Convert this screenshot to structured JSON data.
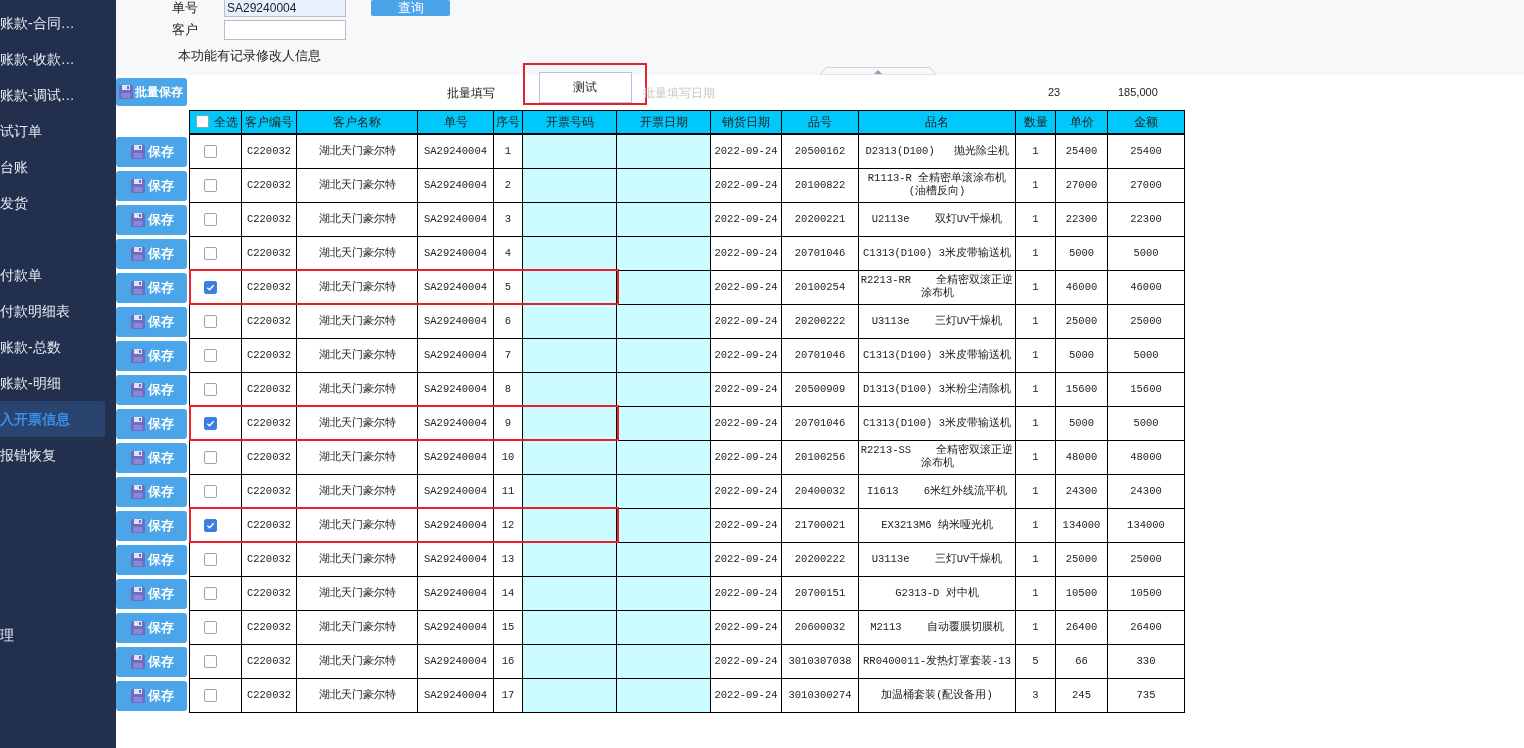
{
  "sidebar": {
    "items": [
      {
        "label": "账款-合同…",
        "selected": false,
        "kind": "item"
      },
      {
        "label": "账款-收款…",
        "selected": false,
        "kind": "item"
      },
      {
        "label": "账款-调试…",
        "selected": false,
        "kind": "item"
      },
      {
        "label": "试订单",
        "selected": false,
        "kind": "item"
      },
      {
        "label": "台账",
        "selected": false,
        "kind": "item"
      },
      {
        "label": "发货",
        "selected": false,
        "kind": "item"
      },
      {
        "label": "付款单",
        "selected": false,
        "kind": "section_start"
      },
      {
        "label": "付款明细表",
        "selected": false,
        "kind": "item"
      },
      {
        "label": "账款-总数",
        "selected": false,
        "kind": "item"
      },
      {
        "label": "账款-明细",
        "selected": false,
        "kind": "item"
      },
      {
        "label": "入开票信息",
        "selected": true,
        "kind": "item"
      },
      {
        "label": "报错恢复",
        "selected": false,
        "kind": "item"
      },
      {
        "label": "理",
        "selected": false,
        "kind": "far"
      }
    ]
  },
  "search": {
    "order_label": "单号",
    "order_value": "SA29240004",
    "query_button": "查询",
    "customer_label": "客户",
    "note": "本功能有记录修改人信息"
  },
  "batch": {
    "save_button": "批量保存",
    "fill_label": "批量填写",
    "fill_value": "测试",
    "fill_highlighted": true,
    "date_placeholder": "批量填写日期",
    "total_qty": "23",
    "total_amount": "185,000"
  },
  "table": {
    "select_all": "全选",
    "select_all_checked": false,
    "columns": [
      "客户编号",
      "客户名称",
      "单号",
      "序号",
      "开票号码",
      "开票日期",
      "销货日期",
      "品号",
      "品名",
      "数量",
      "单价",
      "金额"
    ],
    "save_labels": [
      "保存",
      "保存",
      "保存",
      "保存",
      "保存",
      "保存",
      "保存",
      "保存",
      "保存",
      "保存",
      "保存",
      "保存",
      "保存",
      "保存",
      "保存",
      "保存",
      "保存"
    ],
    "rows": [
      {
        "checked": false,
        "highlighted": false,
        "cells": [
          "C220032",
          "湖北天门豪尔特",
          "SA29240004",
          "1",
          "",
          "",
          "2022-09-24",
          "20500162",
          "D2313(D100)   抛光除尘机",
          "1",
          "25400",
          "25400"
        ]
      },
      {
        "checked": false,
        "highlighted": false,
        "cells": [
          "C220032",
          "湖北天门豪尔特",
          "SA29240004",
          "2",
          "",
          "",
          "2022-09-24",
          "20100822",
          "R1113-R 全精密单滚涂布机(油槽反向)",
          "1",
          "27000",
          "27000"
        ]
      },
      {
        "checked": false,
        "highlighted": false,
        "cells": [
          "C220032",
          "湖北天门豪尔特",
          "SA29240004",
          "3",
          "",
          "",
          "2022-09-24",
          "20200221",
          "U2113e    双灯UV干燥机",
          "1",
          "22300",
          "22300"
        ]
      },
      {
        "checked": false,
        "highlighted": false,
        "cells": [
          "C220032",
          "湖北天门豪尔特",
          "SA29240004",
          "4",
          "",
          "",
          "2022-09-24",
          "20701046",
          "C1313(D100) 3米皮带输送机",
          "1",
          "5000",
          "5000"
        ]
      },
      {
        "checked": true,
        "highlighted": true,
        "cells": [
          "C220032",
          "湖北天门豪尔特",
          "SA29240004",
          "5",
          "",
          "",
          "2022-09-24",
          "20100254",
          "R2213-RR    全精密双滚正逆涂布机",
          "1",
          "46000",
          "46000"
        ]
      },
      {
        "checked": false,
        "highlighted": false,
        "cells": [
          "C220032",
          "湖北天门豪尔特",
          "SA29240004",
          "6",
          "",
          "",
          "2022-09-24",
          "20200222",
          "U3113e    三灯UV干燥机",
          "1",
          "25000",
          "25000"
        ]
      },
      {
        "checked": false,
        "highlighted": false,
        "cells": [
          "C220032",
          "湖北天门豪尔特",
          "SA29240004",
          "7",
          "",
          "",
          "2022-09-24",
          "20701046",
          "C1313(D100) 3米皮带输送机",
          "1",
          "5000",
          "5000"
        ]
      },
      {
        "checked": false,
        "highlighted": false,
        "cells": [
          "C220032",
          "湖北天门豪尔特",
          "SA29240004",
          "8",
          "",
          "",
          "2022-09-24",
          "20500909",
          "D1313(D100) 3米粉尘清除机",
          "1",
          "15600",
          "15600"
        ]
      },
      {
        "checked": true,
        "highlighted": true,
        "cells": [
          "C220032",
          "湖北天门豪尔特",
          "SA29240004",
          "9",
          "",
          "",
          "2022-09-24",
          "20701046",
          "C1313(D100) 3米皮带输送机",
          "1",
          "5000",
          "5000"
        ]
      },
      {
        "checked": false,
        "highlighted": false,
        "cells": [
          "C220032",
          "湖北天门豪尔特",
          "SA29240004",
          "10",
          "",
          "",
          "2022-09-24",
          "20100256",
          "R2213-SS    全精密双滚正逆涂布机",
          "1",
          "48000",
          "48000"
        ]
      },
      {
        "checked": false,
        "highlighted": false,
        "cells": [
          "C220032",
          "湖北天门豪尔特",
          "SA29240004",
          "11",
          "",
          "",
          "2022-09-24",
          "20400032",
          "I1613    6米红外线流平机",
          "1",
          "24300",
          "24300"
        ]
      },
      {
        "checked": true,
        "highlighted": true,
        "cells": [
          "C220032",
          "湖北天门豪尔特",
          "SA29240004",
          "12",
          "",
          "",
          "2022-09-24",
          "21700021",
          "EX3213M6 纳米哑光机",
          "1",
          "134000",
          "134000"
        ]
      },
      {
        "checked": false,
        "highlighted": false,
        "cells": [
          "C220032",
          "湖北天门豪尔特",
          "SA29240004",
          "13",
          "",
          "",
          "2022-09-24",
          "20200222",
          "U3113e    三灯UV干燥机",
          "1",
          "25000",
          "25000"
        ]
      },
      {
        "checked": false,
        "highlighted": false,
        "cells": [
          "C220032",
          "湖北天门豪尔特",
          "SA29240004",
          "14",
          "",
          "",
          "2022-09-24",
          "20700151",
          "G2313-D 对中机",
          "1",
          "10500",
          "10500"
        ]
      },
      {
        "checked": false,
        "highlighted": false,
        "cells": [
          "C220032",
          "湖北天门豪尔特",
          "SA29240004",
          "15",
          "",
          "",
          "2022-09-24",
          "20600032",
          "M2113    自动覆膜切膜机",
          "1",
          "26400",
          "26400"
        ]
      },
      {
        "checked": false,
        "highlighted": false,
        "cells": [
          "C220032",
          "湖北天门豪尔特",
          "SA29240004",
          "16",
          "",
          "",
          "2022-09-24",
          "3010307038",
          "RR0400011-发热灯罩套装-13",
          "5",
          "66",
          "330"
        ]
      },
      {
        "checked": false,
        "highlighted": false,
        "cells": [
          "C220032",
          "湖北天门豪尔特",
          "SA29240004",
          "17",
          "",
          "",
          "2022-09-24",
          "3010300274",
          "加温桶套装(配设备用)",
          "3",
          "245",
          "735"
        ]
      }
    ]
  }
}
